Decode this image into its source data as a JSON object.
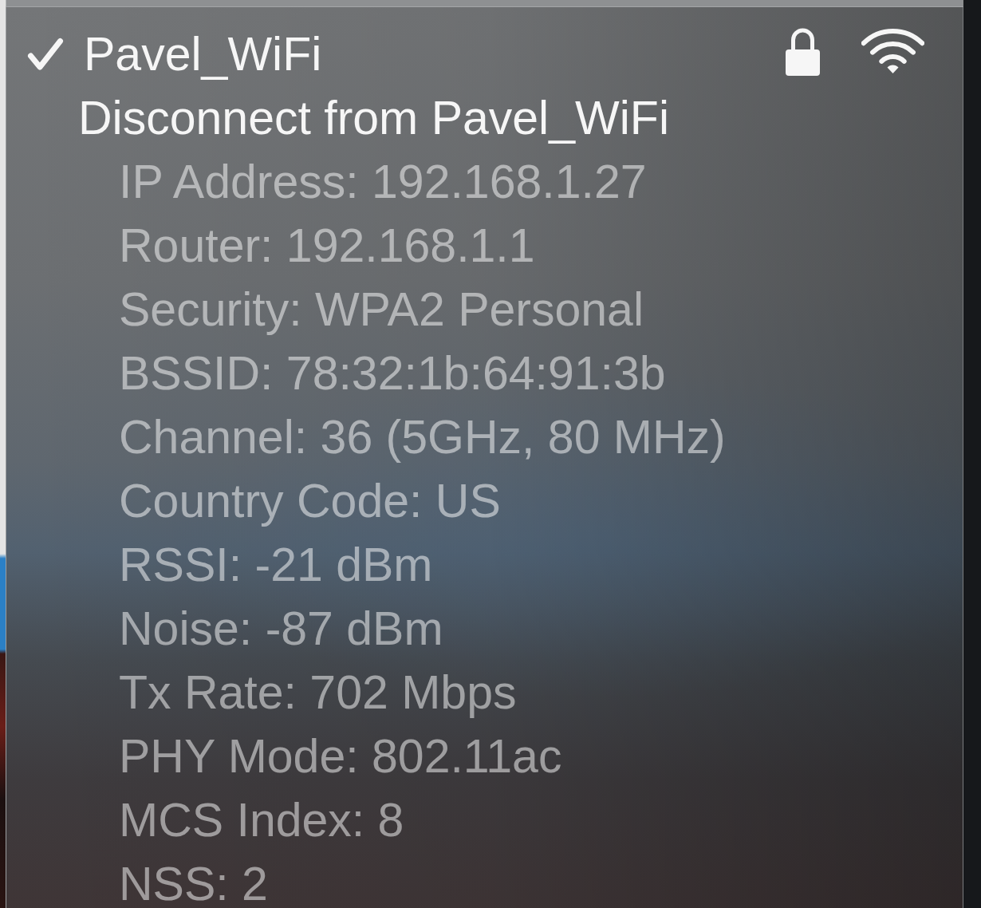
{
  "menu": {
    "network": {
      "name": "Pavel_WiFi",
      "checked": true,
      "secured": true
    },
    "disconnect_item": "Disconnect from Pavel_WiFi",
    "details": [
      {
        "text": "IP Address: 192.168.1.27",
        "disabled": true
      },
      {
        "text": "Router: 192.168.1.1",
        "disabled": true
      },
      {
        "text": "Security: WPA2 Personal",
        "disabled": true
      },
      {
        "text": "BSSID: 78:32:1b:64:91:3b",
        "disabled": true
      },
      {
        "text": "Channel: 36 (5GHz, 80 MHz)",
        "disabled": true
      },
      {
        "text": "Country Code: US",
        "disabled": true
      },
      {
        "text": "RSSI: -21 dBm",
        "disabled": true
      },
      {
        "text": "Noise: -87 dBm",
        "disabled": true
      },
      {
        "text": "Tx Rate: 702 Mbps",
        "disabled": true
      },
      {
        "text": "PHY Mode: 802.11ac",
        "disabled": true
      },
      {
        "text": "MCS Index: 8",
        "disabled": true
      },
      {
        "text": "NSS: 2",
        "disabled": true
      }
    ]
  }
}
